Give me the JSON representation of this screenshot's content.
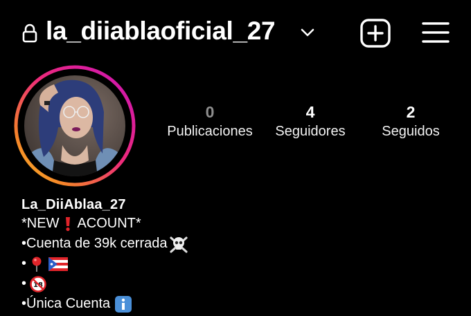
{
  "header": {
    "username": "la_diiablaoficial_27"
  },
  "stats": [
    {
      "num": "0",
      "label": "Publicaciones"
    },
    {
      "num": "4",
      "label": "Seguidores"
    },
    {
      "num": "2",
      "label": "Seguidos"
    }
  ],
  "bio": {
    "name": "La_DiiAblaa_27",
    "line1_a": "*NEW",
    "line1_b": "ACOUNT*",
    "line2": "•Cuenta de 39k cerrada",
    "line3": "•",
    "line4": "•",
    "line5": "•Única Cuenta"
  },
  "icons": {
    "lock": "lock-icon",
    "chevron": "chevron-down-icon",
    "new_post": "plus-square-icon",
    "menu": "hamburger-menu-icon",
    "exclamation": "red-exclamation-emoji",
    "skull": "skull-crossbones-emoji",
    "pin": "round-pushpin-emoji",
    "flag": "puerto-rico-flag-emoji",
    "no_under_18": "no-one-under-18-emoji",
    "info": "information-emoji"
  },
  "colors": {
    "background": "#000000",
    "text": "#ffffff",
    "muted": "#8e8e8e",
    "story_ring_start": "#c913b9",
    "story_ring_end": "#f9a825"
  }
}
